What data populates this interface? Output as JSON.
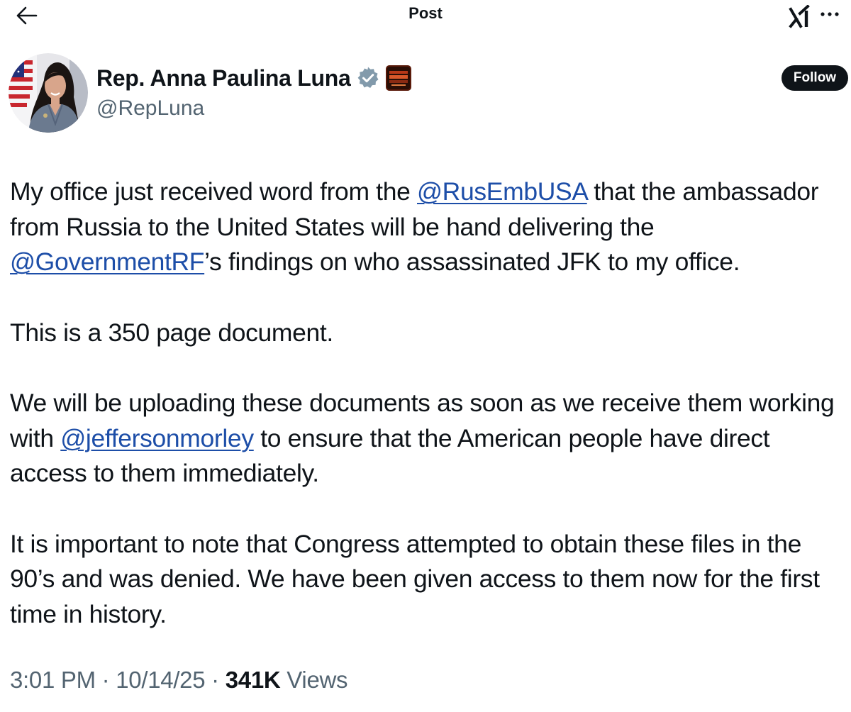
{
  "header": {
    "title": "Post",
    "back_icon": "arrow-left-icon",
    "grok_icon": "grok-logo-icon",
    "more_icon": "more-options-icon"
  },
  "author": {
    "name": "Rep. Anna Paulina Luna",
    "handle": "@RepLuna",
    "verified_badge_color": "#829aab",
    "affiliate_badge_text": "THIS IS A DEMOCRACY",
    "follow_label": "Follow"
  },
  "post": {
    "p1_part1": "My office just received word from the ",
    "p1_mention1": "@RusEmbUSA",
    "p1_part2": " that the ambassador from Russia to the United States will be hand delivering the ",
    "p1_mention2": "@GovernmentRF",
    "p1_part3": "’s findings on who assassinated JFK to my office.",
    "p2": "This is a 350 page document.",
    "p3_part1": "We will be uploading these documents as soon as we receive them working with ",
    "p3_mention": "@jeffersonmorley",
    "p3_part2": " to ensure that the American people have direct access to them immediately.",
    "p4": "It is important to note that Congress attempted to obtain these files in the 90’s and was denied.  We have been given access to them now for the first time in history."
  },
  "meta": {
    "time": "3:01 PM",
    "separator": " · ",
    "date": "10/14/25",
    "views_count": "341K",
    "views_label": " Views"
  },
  "colors": {
    "text": "#0f1419",
    "secondary": "#536471",
    "mention": "#1d4ea8",
    "follow_bg": "#0f1419"
  }
}
